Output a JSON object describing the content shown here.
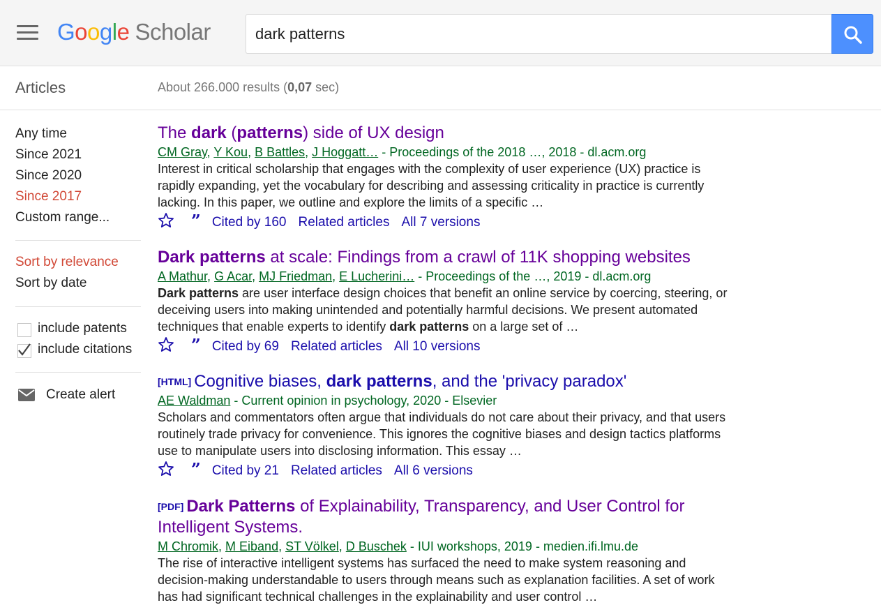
{
  "header": {
    "logo_google": [
      "G",
      "o",
      "o",
      "g",
      "l",
      "e"
    ],
    "logo_scholar": "Scholar",
    "search_value": "dark patterns",
    "search_icon": "search-icon",
    "menu_icon": "hamburger-menu-icon"
  },
  "subbar": {
    "articles_label": "Articles",
    "results_prefix": "About 266.000 results (",
    "results_time": "0,07",
    "results_suffix": " sec)"
  },
  "sidebar": {
    "time_filters": [
      "Any time",
      "Since 2021",
      "Since 2020",
      "Since 2017",
      "Custom range..."
    ],
    "active_time": "Since 2017",
    "sort_options": [
      "Sort by relevance",
      "Sort by date"
    ],
    "active_sort": "Sort by relevance",
    "include_patents": {
      "label": "include patents",
      "checked": false
    },
    "include_citations": {
      "label": "include citations",
      "checked": true
    },
    "create_alert": "Create alert"
  },
  "results": [
    {
      "tag": "",
      "title_html": "The <b>dark</b> (<b>patterns</b>) side of UX design",
      "authors": [
        "CM Gray",
        "Y Kou",
        "B Battles",
        "J Hoggatt…"
      ],
      "source": " - Proceedings of the 2018 …, 2018 - dl.acm.org",
      "snippet_html": "Interest in critical scholarship that engages with the complexity of user experience (UX) practice is rapidly expanding, yet the vocabulary for describing and assessing criticality in practice is currently lacking. In this paper, we outline and explore the limits of a specific …",
      "cited_by": "Cited by 160",
      "related": "Related articles",
      "versions": "All 7 versions"
    },
    {
      "tag": "",
      "title_html": "<b>Dark patterns</b> at scale: Findings from a crawl of 11K shopping websites",
      "authors": [
        "A Mathur",
        "G Acar",
        "MJ Friedman",
        "E Lucherini…"
      ],
      "source": " - Proceedings of the …, 2019 - dl.acm.org",
      "snippet_html": "<b>Dark patterns</b> are user interface design choices that benefit an online service by coercing, steering, or deceiving users into making unintended and potentially harmful decisions. We present automated techniques that enable experts to identify <b>dark patterns</b> on a large set of …",
      "cited_by": "Cited by 69",
      "related": "Related articles",
      "versions": "All 10 versions"
    },
    {
      "tag": "[HTML]",
      "title_html": "Cognitive biases, <b>dark patterns</b>, and the 'privacy paradox'",
      "authors": [
        "AE Waldman"
      ],
      "source": " - Current opinion in psychology, 2020 - Elsevier",
      "snippet_html": "Scholars and commentators often argue that individuals do not care about their privacy, and that users routinely trade privacy for convenience. This ignores the cognitive biases and design tactics platforms use to manipulate users into disclosing information. This essay …",
      "cited_by": "Cited by 21",
      "related": "Related articles",
      "versions": "All 6 versions"
    },
    {
      "tag": "[PDF]",
      "title_html": "<b>Dark Patterns</b> of Explainability, Transparency, and User Control for Intelligent Systems.",
      "authors": [
        "M Chromik",
        "M Eiband",
        "ST Völkel",
        "D Buschek"
      ],
      "source": " - IUI workshops, 2019 - medien.ifi.lmu.de",
      "snippet_html": "The rise of interactive intelligent systems has surfaced the need to make system reasoning and decision-making understandable to users through means such as explanation facilities. A set of work has had significant technical challenges in the explainability and user control …",
      "cited_by": "",
      "related": "",
      "versions": ""
    }
  ],
  "colors": {
    "visited_title": "#660099",
    "link": "#1a0dab",
    "meta_green": "#006621",
    "active_red": "#d14836",
    "search_blue": "#4d90fe"
  }
}
